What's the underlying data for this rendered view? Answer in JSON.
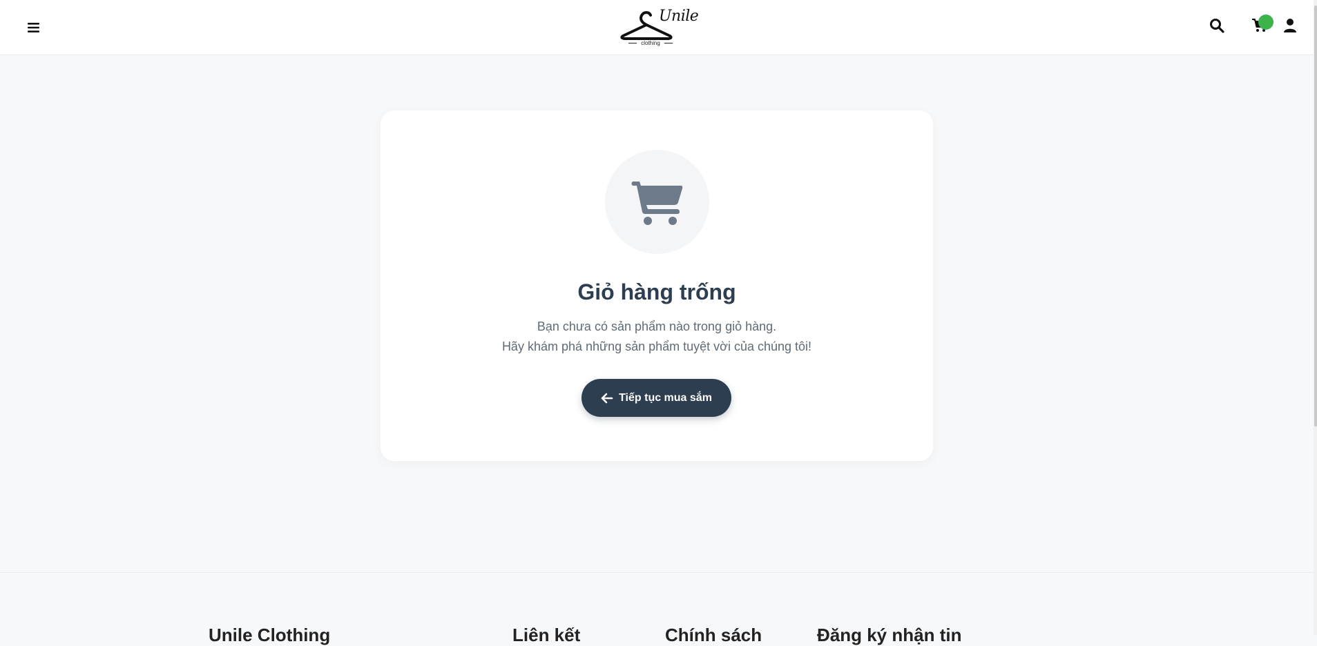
{
  "header": {
    "logo_script": "Unile",
    "logo_sub": "clothing",
    "icons": {
      "menu": "hamburger-menu-icon",
      "search": "search-icon",
      "cart": "cart-icon",
      "user": "user-icon"
    },
    "cart_badge_color": "#3cb44b"
  },
  "empty_cart": {
    "icon": "cart-icon",
    "title": "Giỏ hàng trống",
    "line1": "Bạn chưa có sản phẩm nào trong giỏ hàng.",
    "line2": "Hãy khám phá những sản phẩm tuyệt vời của chúng tôi!",
    "button_label": "Tiếp tục mua sắm",
    "button_icon": "arrow-left-icon"
  },
  "footer": {
    "headings": [
      "Unile Clothing",
      "Liên kết",
      "Chính sách",
      "Đăng ký nhận tin"
    ]
  },
  "colors": {
    "primary": "#2c3e50",
    "background": "#f7f8fa",
    "badge": "#3cb44b"
  }
}
